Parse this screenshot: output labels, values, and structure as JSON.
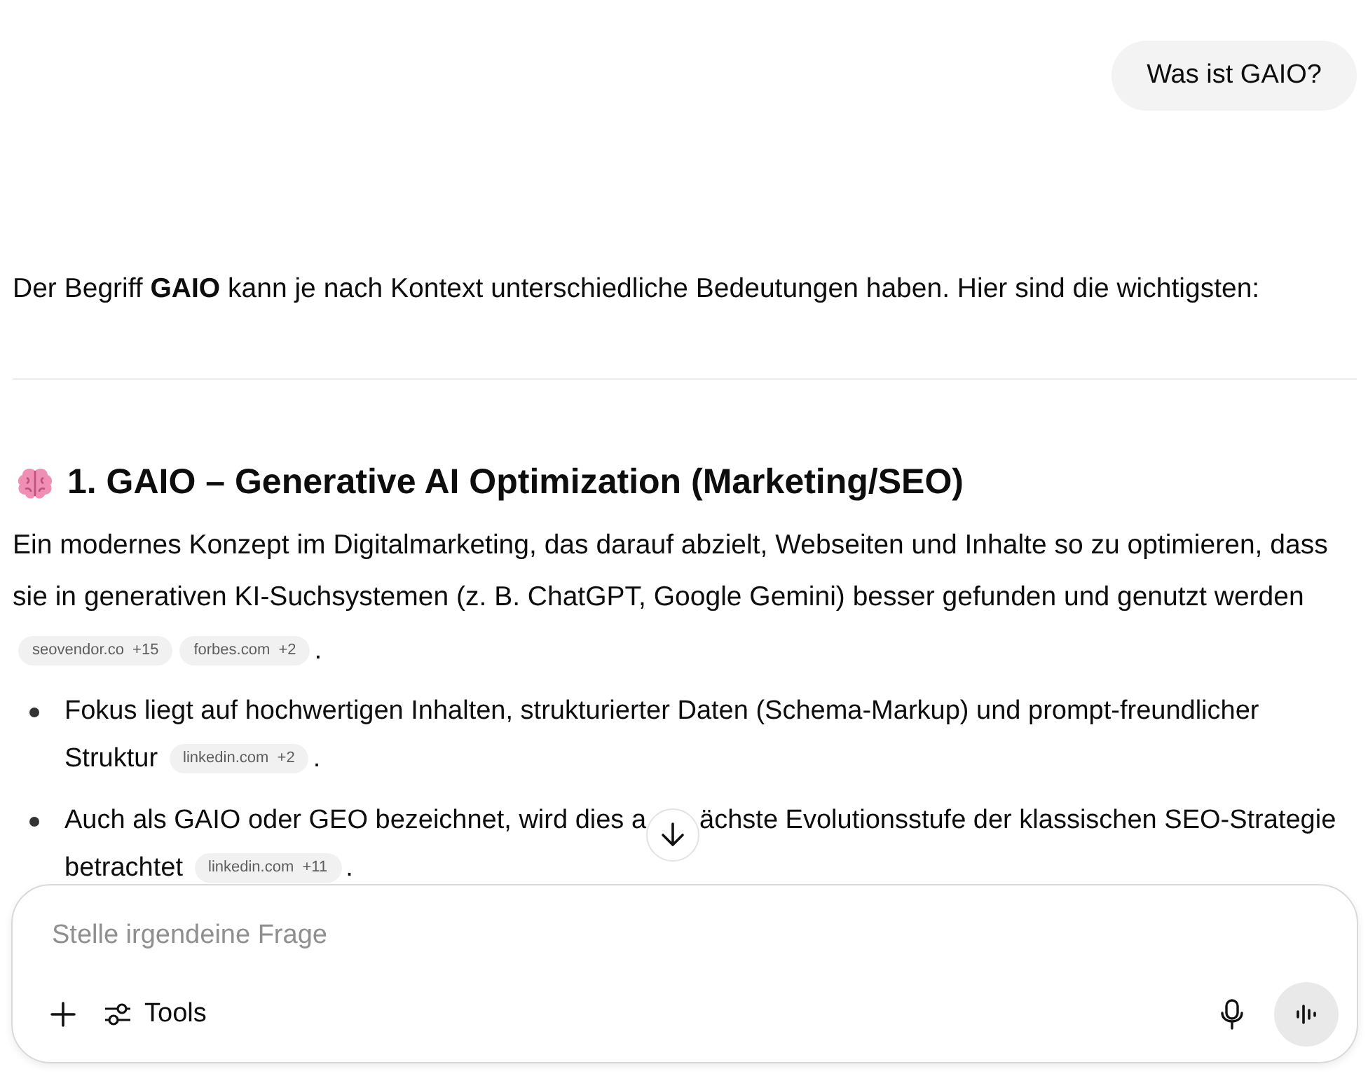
{
  "user_message": "Was ist GAIO?",
  "intro": "Der Begriff **GAIO** kann je nach Kontext unterschiedliche Bedeutungen haben. Hier sind die wichtigsten:",
  "section": {
    "number": "1.",
    "title": "GAIO – Generative AI Optimization (Marketing/SEO)",
    "text": "Ein modernes Konzept im Digitalmarketing, das darauf abzielt, Webseiten und Inhalte so zu optimieren, dass sie in generativen KI-Suchsystemen (z. B. ChatGPT, Google Gemini) besser gefunden und genutzt werden",
    "sources": [
      {
        "site": "seovendor.co",
        "more": "+15"
      },
      {
        "site": "forbes.com",
        "more": "+2"
      }
    ],
    "end": ".",
    "bullets": [
      {
        "text_before": "Fokus liegt auf hochwertigen Inhalten, strukturierter Daten (Schema-Markup) und prompt-freundlicher",
        "text_next": "Struktur",
        "sources": [
          {
            "site": "linkedin.com",
            "more": "+2"
          }
        ],
        "end": "."
      },
      {
        "text_before": "Auch als GAIO oder GEO bezeichnet, wird dies a",
        "text_after": "ächste Evolutionsstufe der klassischen SEO-Strategie",
        "text_next": "betrachtet",
        "sources": [
          {
            "site": "linkedin.com",
            "more": "+11"
          }
        ],
        "end": "."
      }
    ]
  },
  "composer": {
    "placeholder": "Stelle irgendeine Frage",
    "tools_label": "Tools"
  }
}
